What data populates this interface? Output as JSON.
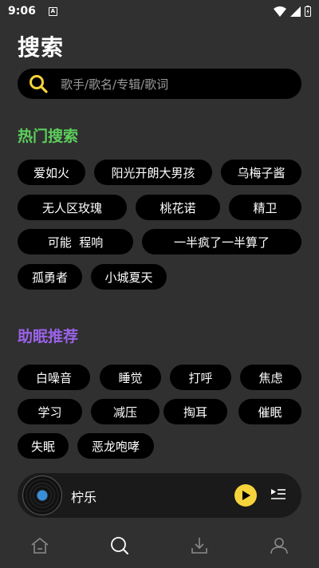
{
  "status_bar": {
    "time": "9:06",
    "notif_letter": "A"
  },
  "page_title": "搜索",
  "search": {
    "placeholder": "歌手/歌名/专辑/歌词"
  },
  "hot_search": {
    "title": "热门搜索",
    "tags": [
      "爱如火",
      "阳光开朗大男孩",
      "乌梅子酱",
      "无人区玫瑰",
      "桃花诺",
      "精卫",
      "可能  程响",
      "一半疯了一半算了",
      "孤勇者",
      "小城夏天"
    ]
  },
  "sleep": {
    "title": "助眠推荐",
    "tags": [
      "白噪音",
      "睡觉",
      "打呼",
      "焦虑",
      "学习",
      "减压",
      "掏耳",
      "催眠",
      "失眠",
      "恶龙咆哮"
    ]
  },
  "player": {
    "song_title": "柠乐"
  },
  "nav": {
    "items": [
      "home",
      "search",
      "download",
      "profile"
    ],
    "active": "search"
  },
  "colors": {
    "hot_title": "#5ccf5c",
    "sleep_title": "#9a62e8",
    "search_icon": "#f5d33b",
    "play_button": "#f5d33b"
  }
}
